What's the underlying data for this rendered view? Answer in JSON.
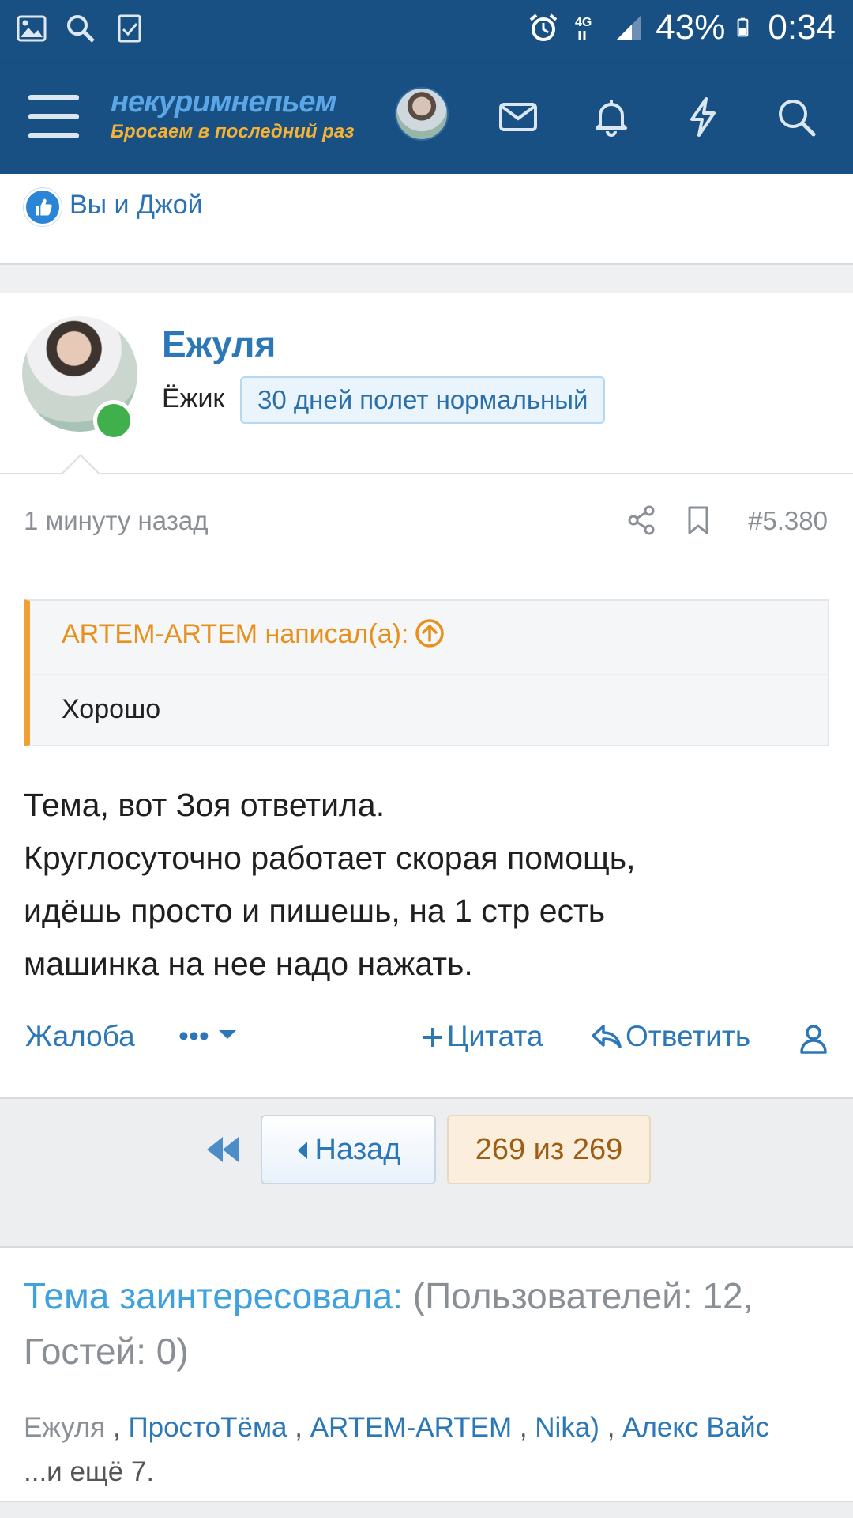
{
  "status_bar": {
    "battery": "43%",
    "time": "0:34",
    "network": "4G"
  },
  "header": {
    "logo_main": "некуримнепьем",
    "logo_sub": "Бросаем в последний раз"
  },
  "likes": {
    "text": "Вы и Джой"
  },
  "post": {
    "username": "Ежуля",
    "user_title": "Ёжик",
    "banner": "30 дней полет нормальный",
    "time": "1 минуту назад",
    "number": "#5.380",
    "quote": {
      "author": "ARTEM-ARTEM написал(а):",
      "text": "Хорошо"
    },
    "body": [
      "Тема, вот Зоя ответила.",
      "Круглосуточно работает скорая помощь,",
      "идёшь просто и пишешь, на 1 стр есть",
      "машинка на нее надо нажать."
    ],
    "actions": {
      "report": "Жалоба",
      "more": "•••",
      "quote": "Цитата",
      "reply": "Ответить"
    }
  },
  "pagination": {
    "prev": "Назад",
    "current": "269 из 269"
  },
  "watchers": {
    "title": "Тема заинтересовала:",
    "counts": "(Пользователей: 12, Гостей: 0)",
    "users": [
      "Ежуля",
      "ПростоТёма",
      "ARTEM-ARTEM",
      "Nika)",
      "Алекс Вайс"
    ],
    "more": "...и ещё 7."
  },
  "colors": {
    "header_bg": "#195084",
    "link": "#2b77b8",
    "quote_accent": "#f0a033",
    "online": "#3fb04b"
  }
}
